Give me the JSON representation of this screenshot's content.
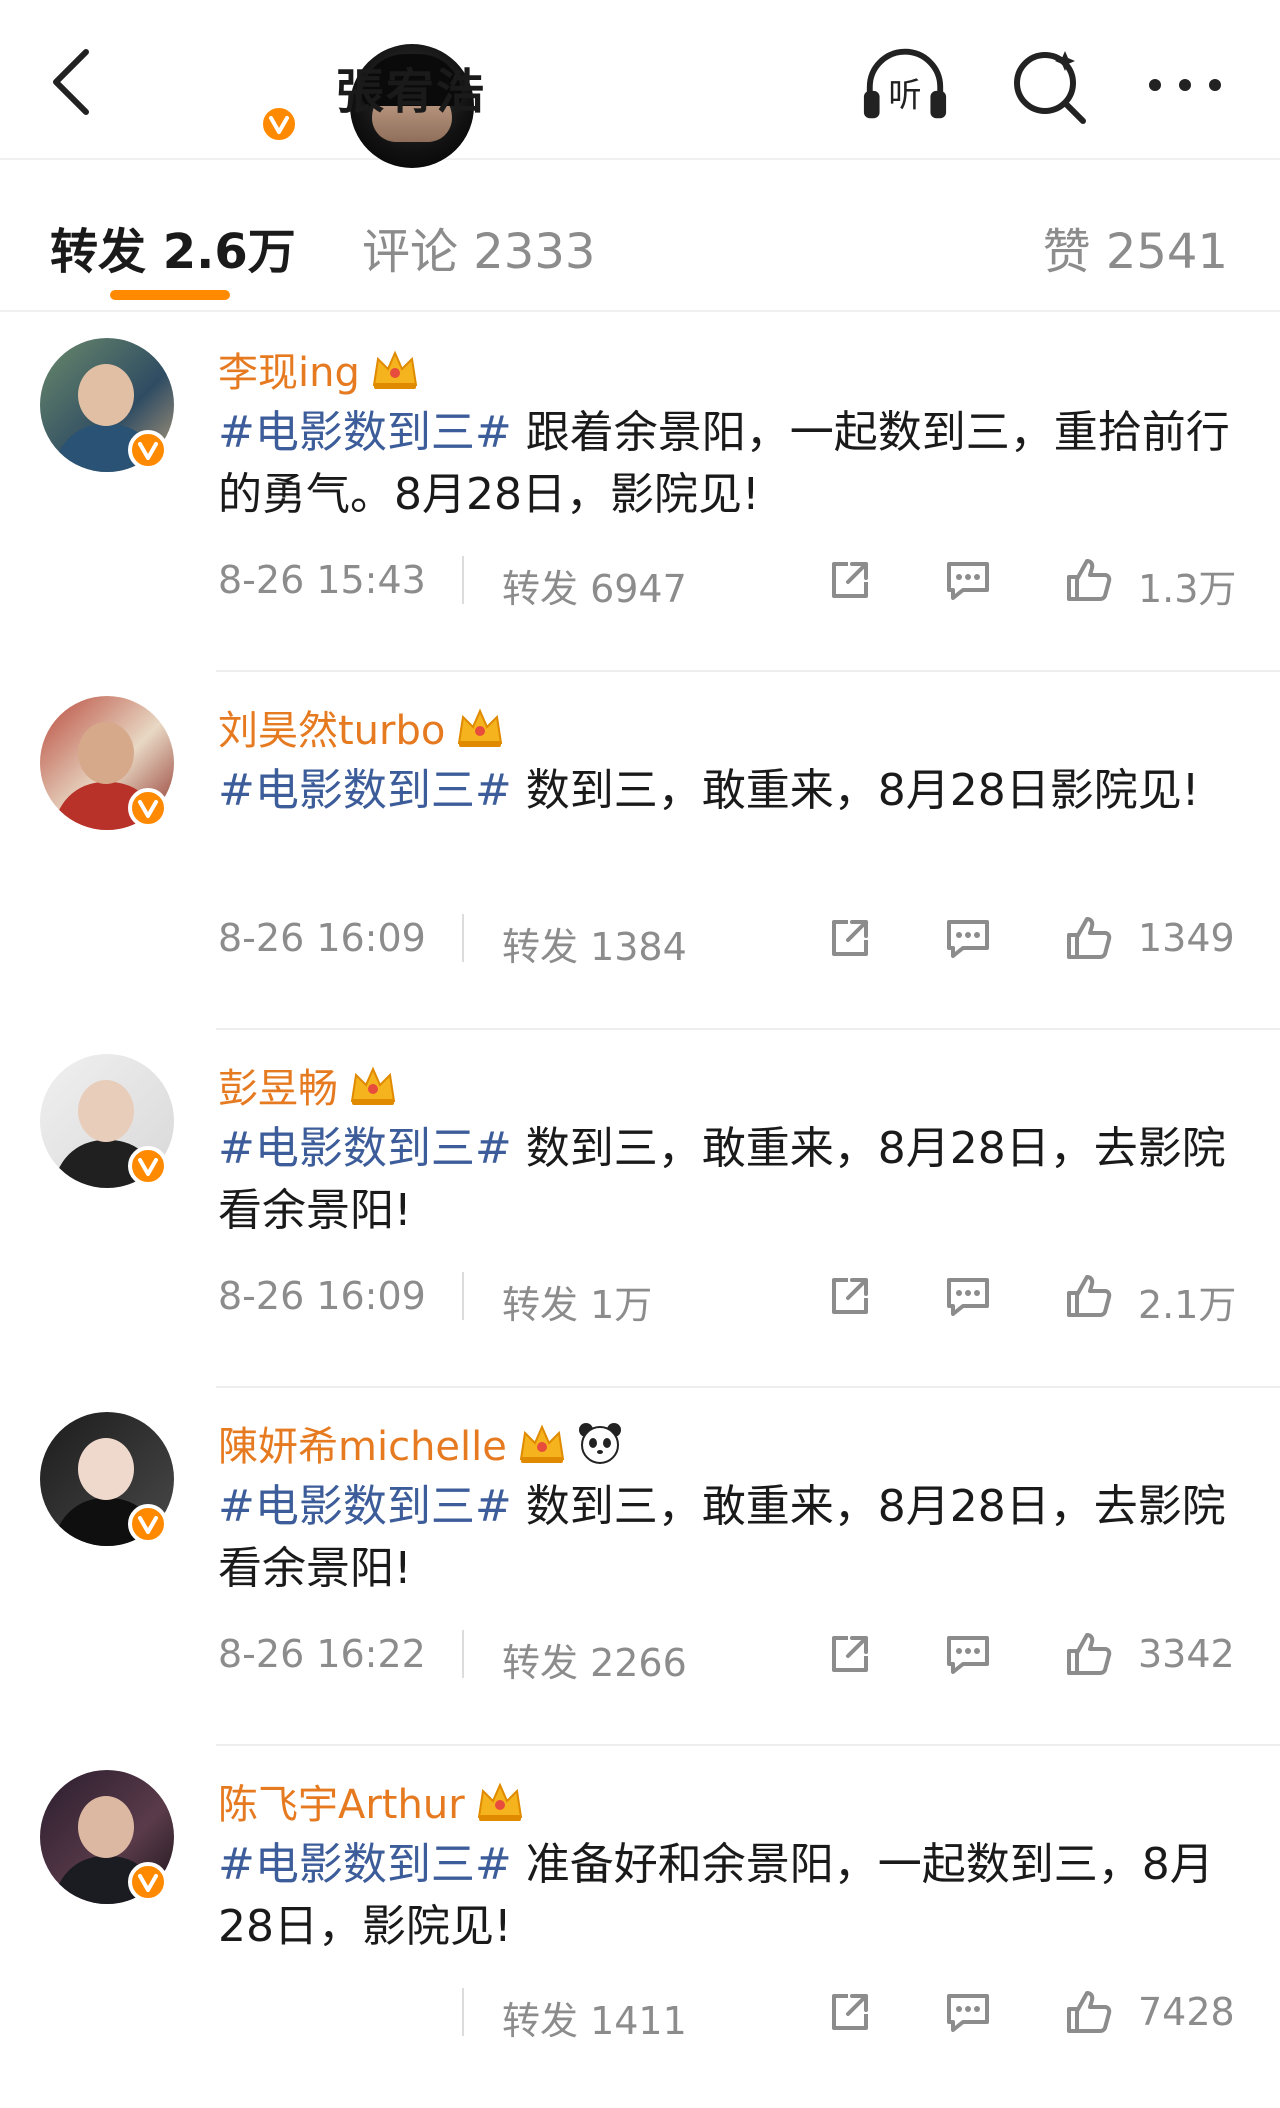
{
  "header": {
    "user_name": "張宥浩",
    "icons": [
      "back-icon",
      "listen-icon",
      "search-icon",
      "more-icon"
    ],
    "listen_glyph": "听"
  },
  "tabs": [
    {
      "label": "转发 2.6万"
    },
    {
      "label": "评论 2333"
    },
    {
      "label": "赞 2541"
    }
  ],
  "accent_color": "#ff8a00",
  "link_color": "#3d5d9a",
  "name_color": "#e67a20",
  "reposts": [
    {
      "user": "李现ing",
      "hashtag": "#电影数到三#",
      "text": " 跟着余景阳，一起数到三，重拾前行的勇气。8月28日，影院见!",
      "time": "8-26 15:43",
      "reposts": "转发 6947",
      "likes": "1.3万"
    },
    {
      "user": "刘昊然turbo",
      "hashtag": "#电影数到三#",
      "text": " 数到三，敢重来，8月28日影院见!",
      "time": "8-26 16:09",
      "reposts": "转发 1384",
      "likes": "1349"
    },
    {
      "user": "彭昱畅",
      "hashtag": "#电影数到三#",
      "text": " 数到三，敢重来，8月28日，去影院看余景阳!",
      "time": "8-26 16:09",
      "reposts": "转发 1万",
      "likes": "2.1万"
    },
    {
      "user": "陳妍希michelle",
      "hashtag": "#电影数到三#",
      "text": " 数到三，敢重来，8月28日，去影院看余景阳!",
      "time": "8-26 16:22",
      "reposts": "转发 2266",
      "likes": "3342"
    },
    {
      "user": "陈飞宇Arthur",
      "hashtag": "#电影数到三#",
      "text": " 准备好和余景阳，一起数到三，8月28日，影院见!",
      "time": "",
      "reposts": "转发 1411",
      "likes": "7428"
    }
  ]
}
